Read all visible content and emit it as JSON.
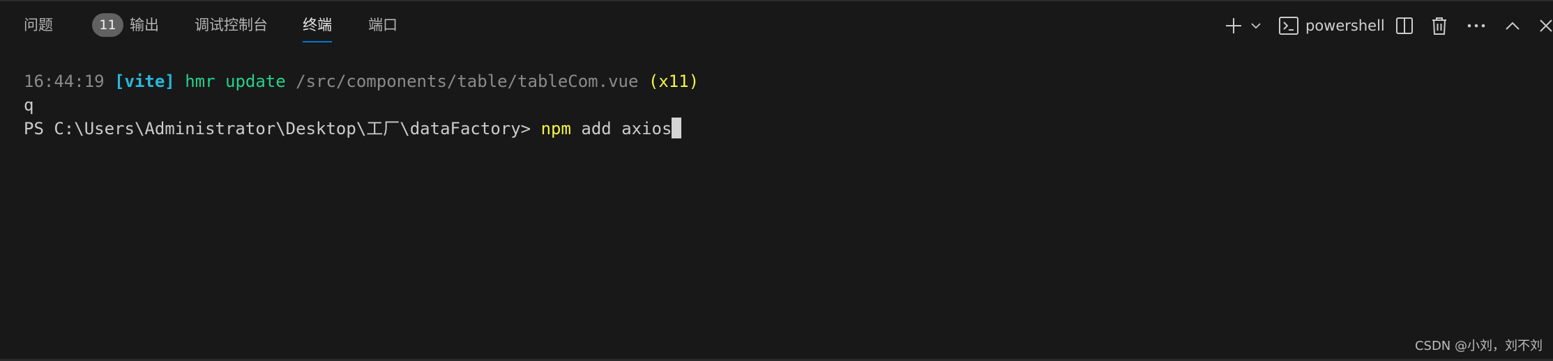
{
  "tabs": [
    {
      "label": "问题",
      "badge": "11"
    },
    {
      "label": "输出"
    },
    {
      "label": "调试控制台"
    },
    {
      "label": "终端"
    },
    {
      "label": "端口"
    }
  ],
  "active_tab": "终端",
  "toolbar": {
    "shell_name": "powershell",
    "icons": [
      "plus-icon",
      "chevron-down-icon",
      "terminal-icon",
      "split-icon",
      "trash-icon",
      "more-icon",
      "chevron-up-icon",
      "close-icon"
    ]
  },
  "terminal": {
    "line1": {
      "time": "16:44:19",
      "tag": "[vite]",
      "action": "hmr update",
      "path": "/src/components/table/tableCom.vue",
      "count": "(x11)"
    },
    "line2": "q",
    "line3": {
      "prompt": "PS C:\\Users\\Administrator\\Desktop\\工厂\\dataFactory>",
      "command": "npm",
      "args": "add axios"
    }
  },
  "watermark": "CSDN @小刘，刘不刘",
  "colors": {
    "background": "#181818",
    "accent": "#0078d4",
    "vite_tag": "#29b8db",
    "green": "#23d18b",
    "yellow": "#f5f543",
    "badge": "#616161"
  }
}
